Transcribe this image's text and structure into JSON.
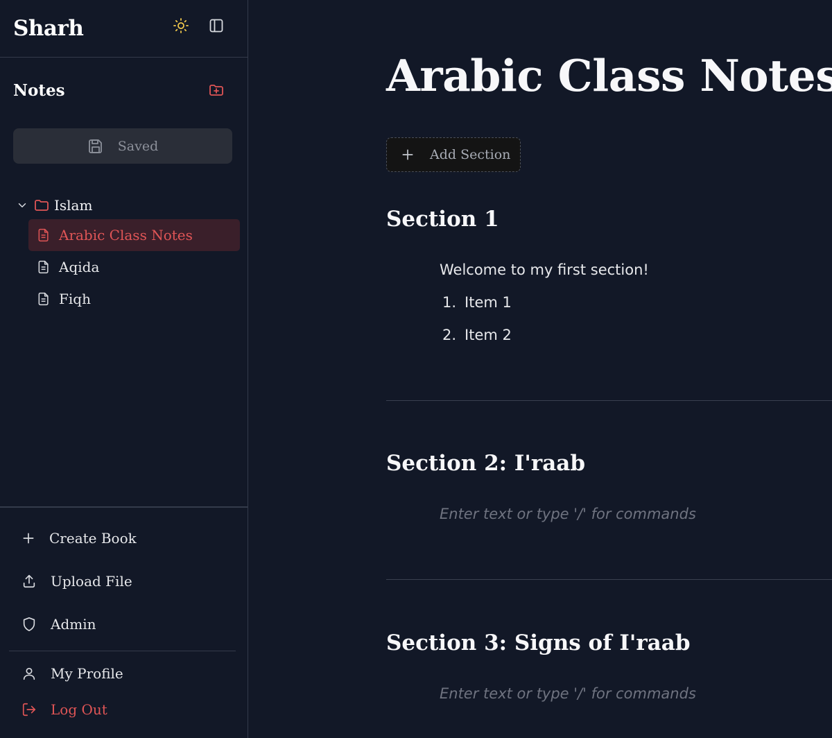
{
  "app": {
    "brand": "Sharh"
  },
  "sidebar": {
    "notes_title": "Notes",
    "saved_label": "Saved",
    "folder": {
      "name": "Islam",
      "items": [
        {
          "label": "Arabic Class Notes",
          "active": true
        },
        {
          "label": "Aqida",
          "active": false
        },
        {
          "label": "Fiqh",
          "active": false
        }
      ]
    },
    "bottom": {
      "create_book": "Create Book",
      "upload_file": "Upload File",
      "admin": "Admin",
      "my_profile": "My Profile",
      "log_out": "Log Out"
    }
  },
  "main": {
    "title": "Arabic Class Notes",
    "add_section_label": "Add Section",
    "sections": [
      {
        "title": "Section 1",
        "text": "Welcome to my first section!",
        "list": [
          {
            "num": "1.",
            "text": "Item 1"
          },
          {
            "num": "2.",
            "text": "Item 2"
          }
        ]
      },
      {
        "title": "Section 2: I'raab",
        "placeholder": "Enter text or type '/' for commands"
      },
      {
        "title": "Section 3: Signs of I'raab",
        "placeholder": "Enter text or type '/' for commands"
      }
    ]
  },
  "colors": {
    "background": "#121827",
    "accent": "#e05556",
    "sun_icon": "#f2c94c",
    "active_item_bg": "#3a1f2a"
  }
}
